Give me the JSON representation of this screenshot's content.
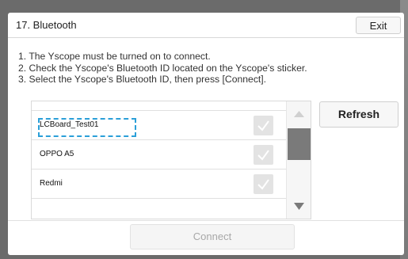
{
  "dialog": {
    "title": "17. Bluetooth",
    "exit_label": "Exit"
  },
  "instructions": [
    "1. The Yscope must be turned on to connect.",
    "2. Check the Yscope's Bluetooth ID located on the Yscope's sticker.",
    "3. Select the Yscope's Bluetooth ID, then press [Connect]."
  ],
  "device_list": {
    "items": [
      {
        "label": "LCBoard_Test01",
        "focused": true
      },
      {
        "label": "OPPO A5"
      },
      {
        "label": "Redmi"
      }
    ],
    "check_icon": "check-icon"
  },
  "buttons": {
    "refresh_label": "Refresh",
    "connect_label": "Connect",
    "connect_enabled": false
  },
  "colors": {
    "focus_ring": "#2b9fd8",
    "scroll_thumb": "#7a7a7a",
    "disabled_text": "#a8a8a8"
  }
}
